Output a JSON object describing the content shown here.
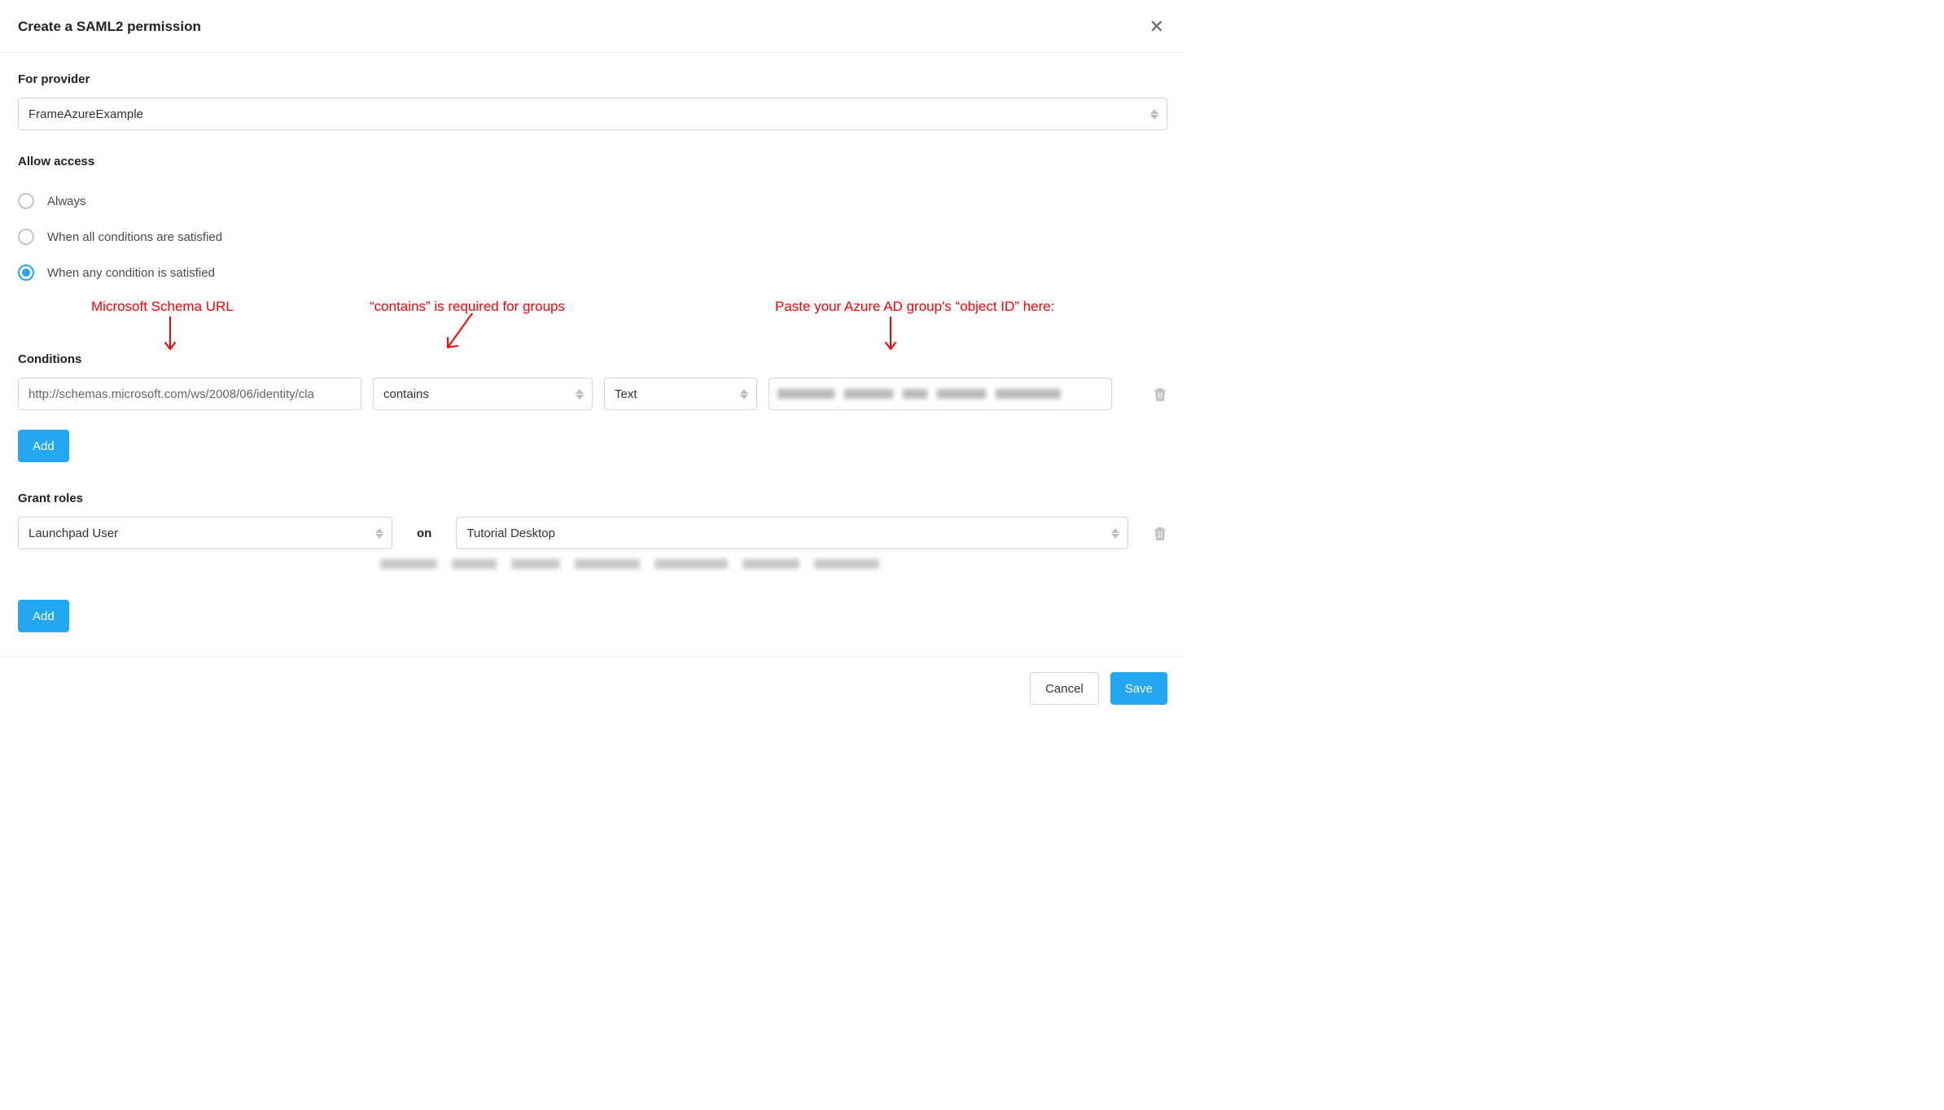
{
  "header": {
    "title": "Create a SAML2 permission"
  },
  "provider": {
    "label": "For provider",
    "value": "FrameAzureExample"
  },
  "access": {
    "label": "Allow access",
    "options": [
      {
        "label": "Always",
        "selected": false
      },
      {
        "label": "When all conditions are satisfied",
        "selected": false
      },
      {
        "label": "When any condition is satisfied",
        "selected": true
      }
    ]
  },
  "annotations": {
    "schema": "Microsoft Schema URL",
    "contains": "“contains” is required for groups",
    "objectid": "Paste your Azure AD group's “object ID” here:"
  },
  "conditions": {
    "label": "Conditions",
    "row": {
      "claim": "http://schemas.microsoft.com/ws/2008/06/identity/cla",
      "operator": "contains",
      "valueType": "Text",
      "value": ""
    },
    "add_label": "Add"
  },
  "roles": {
    "label": "Grant roles",
    "role": "Launchpad User",
    "on_text": "on",
    "target": "Tutorial Desktop",
    "add_label": "Add"
  },
  "footer": {
    "cancel": "Cancel",
    "save": "Save"
  }
}
